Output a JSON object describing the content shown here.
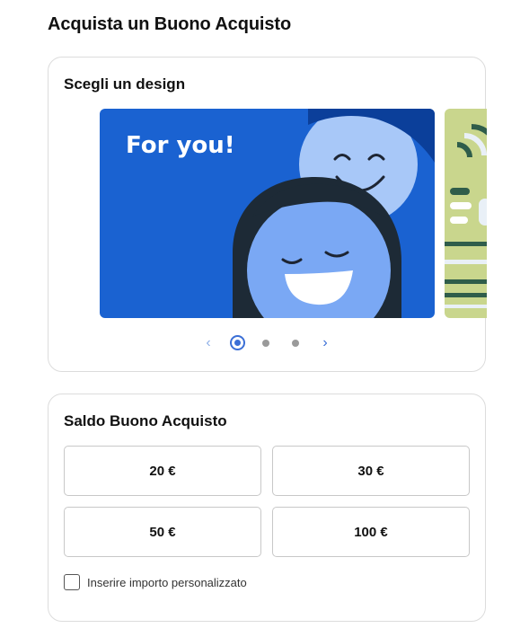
{
  "page": {
    "title": "Acquista un Buono Acquisto"
  },
  "design": {
    "title": "Scegli un design",
    "slides": [
      {
        "text": "For you!",
        "active": true
      },
      {
        "text": "",
        "active": false
      },
      {
        "text": "",
        "active": false
      }
    ],
    "prev_icon": "chevron-left-icon",
    "next_icon": "chevron-right-icon"
  },
  "amount": {
    "title": "Saldo Buono Acquisto",
    "options": [
      "20 €",
      "30 €",
      "50 €",
      "100 €"
    ],
    "custom_label": "Inserire importo personalizzato",
    "custom_checked": false
  },
  "colors": {
    "accent": "#3b6fd6",
    "slide_bg": "#1a62d1",
    "border": "#dcdcdc"
  }
}
